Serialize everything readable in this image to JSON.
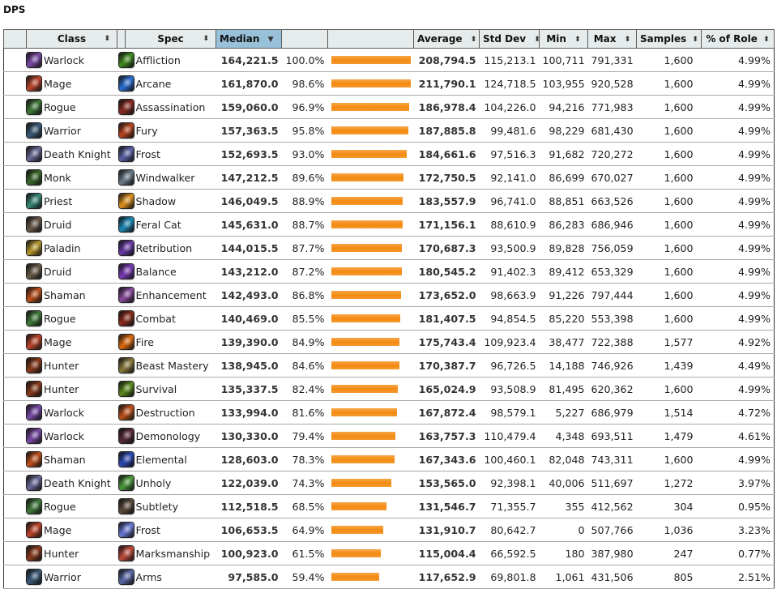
{
  "page": {
    "title": "DPS"
  },
  "colors": {
    "header_bg": "#e6ecec",
    "sorted_header_bg": "#98c0d8",
    "bar": "#f28a10",
    "row_border": "#a8a8a8"
  },
  "table": {
    "headers": {
      "class": "Class",
      "spec": "Spec",
      "median": "Median",
      "pct": "",
      "bar": "",
      "average": "Average",
      "stddev": "Std Dev",
      "min": "Min",
      "max": "Max",
      "samples": "Samples",
      "role": "% of Role"
    },
    "sort_icon": "⬍",
    "sorted_icon": "▼",
    "sorted_column": "Median",
    "rows": [
      {
        "class": "Warlock",
        "class_icon": "warlock-icon",
        "class_color": "#7a4aa8",
        "spec": "Affliction",
        "spec_icon": "affliction-icon",
        "spec_color": "#3f8a1e",
        "median": "164,221.5",
        "pct": "100.0%",
        "bar_fraction": 1.0,
        "average": "208,794.5",
        "stddev": "115,213.1",
        "min": "100,711",
        "max": "791,331",
        "samples": "1,600",
        "role": "4.99%"
      },
      {
        "class": "Mage",
        "class_icon": "mage-icon",
        "class_color": "#c0452a",
        "spec": "Arcane",
        "spec_icon": "arcane-icon",
        "spec_color": "#2a6fd6",
        "median": "161,870.0",
        "pct": "98.6%",
        "bar_fraction": 0.986,
        "average": "211,790.1",
        "stddev": "124,718.5",
        "min": "103,955",
        "max": "920,528",
        "samples": "1,600",
        "role": "4.99%"
      },
      {
        "class": "Rogue",
        "class_icon": "rogue-icon",
        "class_color": "#3f7a3a",
        "spec": "Assassination",
        "spec_icon": "assassination-icon",
        "spec_color": "#8a2a22",
        "median": "159,060.0",
        "pct": "96.9%",
        "bar_fraction": 0.969,
        "average": "186,978.4",
        "stddev": "104,226.0",
        "min": "94,216",
        "max": "771,983",
        "samples": "1,600",
        "role": "4.99%"
      },
      {
        "class": "Warrior",
        "class_icon": "warrior-icon",
        "class_color": "#3a5a78",
        "spec": "Fury",
        "spec_icon": "fury-icon",
        "spec_color": "#b8441c",
        "median": "157,363.5",
        "pct": "95.8%",
        "bar_fraction": 0.958,
        "average": "187,885.8",
        "stddev": "99,481.6",
        "min": "98,229",
        "max": "681,430",
        "samples": "1,600",
        "role": "4.99%"
      },
      {
        "class": "Death Knight",
        "class_icon": "death-knight-icon",
        "class_color": "#6a6a9a",
        "spec": "Frost",
        "spec_icon": "dk-frost-icon",
        "spec_color": "#5a62a8",
        "median": "152,693.5",
        "pct": "93.0%",
        "bar_fraction": 0.93,
        "average": "184,661.6",
        "stddev": "97,516.3",
        "min": "91,682",
        "max": "720,272",
        "samples": "1,600",
        "role": "4.99%"
      },
      {
        "class": "Monk",
        "class_icon": "monk-icon",
        "class_color": "#3a6a2a",
        "spec": "Windwalker",
        "spec_icon": "windwalker-icon",
        "spec_color": "#6a7a8a",
        "median": "147,212.5",
        "pct": "89.6%",
        "bar_fraction": 0.896,
        "average": "172,750.5",
        "stddev": "92,141.0",
        "min": "86,699",
        "max": "670,027",
        "samples": "1,600",
        "role": "4.99%"
      },
      {
        "class": "Priest",
        "class_icon": "priest-icon",
        "class_color": "#3a8a7a",
        "spec": "Shadow",
        "spec_icon": "shadow-icon",
        "spec_color": "#e0901a",
        "median": "146,049.5",
        "pct": "88.9%",
        "bar_fraction": 0.889,
        "average": "183,557.9",
        "stddev": "96,741.0",
        "min": "88,851",
        "max": "663,526",
        "samples": "1,600",
        "role": "4.99%"
      },
      {
        "class": "Druid",
        "class_icon": "druid-icon",
        "class_color": "#6a5a4a",
        "spec": "Feral Cat",
        "spec_icon": "feral-icon",
        "spec_color": "#1a8ab8",
        "median": "145,631.0",
        "pct": "88.7%",
        "bar_fraction": 0.887,
        "average": "171,156.1",
        "stddev": "88,610.9",
        "min": "86,283",
        "max": "686,946",
        "samples": "1,600",
        "role": "4.99%"
      },
      {
        "class": "Paladin",
        "class_icon": "paladin-icon",
        "class_color": "#b8962a",
        "spec": "Retribution",
        "spec_icon": "retribution-icon",
        "spec_color": "#6a3aa8",
        "median": "144,015.5",
        "pct": "87.7%",
        "bar_fraction": 0.877,
        "average": "170,687.3",
        "stddev": "93,500.9",
        "min": "89,828",
        "max": "756,059",
        "samples": "1,600",
        "role": "4.99%"
      },
      {
        "class": "Druid",
        "class_icon": "druid-icon",
        "class_color": "#6a5a4a",
        "spec": "Balance",
        "spec_icon": "balance-icon",
        "spec_color": "#7a3ab8",
        "median": "143,212.0",
        "pct": "87.2%",
        "bar_fraction": 0.872,
        "average": "180,545.2",
        "stddev": "91,402.3",
        "min": "89,412",
        "max": "653,329",
        "samples": "1,600",
        "role": "4.99%"
      },
      {
        "class": "Shaman",
        "class_icon": "shaman-icon",
        "class_color": "#c0501a",
        "spec": "Enhancement",
        "spec_icon": "enhancement-icon",
        "spec_color": "#8a4aa0",
        "median": "142,493.0",
        "pct": "86.8%",
        "bar_fraction": 0.868,
        "average": "173,652.0",
        "stddev": "98,663.9",
        "min": "91,226",
        "max": "797,444",
        "samples": "1,600",
        "role": "4.99%"
      },
      {
        "class": "Rogue",
        "class_icon": "rogue-icon",
        "class_color": "#3f7a3a",
        "spec": "Combat",
        "spec_icon": "combat-icon",
        "spec_color": "#8a2a1a",
        "median": "140,469.0",
        "pct": "85.5%",
        "bar_fraction": 0.855,
        "average": "181,407.5",
        "stddev": "94,854.5",
        "min": "85,220",
        "max": "553,398",
        "samples": "1,600",
        "role": "4.99%"
      },
      {
        "class": "Mage",
        "class_icon": "mage-icon",
        "class_color": "#c0452a",
        "spec": "Fire",
        "spec_icon": "fire-icon",
        "spec_color": "#e06a0a",
        "median": "139,390.0",
        "pct": "84.9%",
        "bar_fraction": 0.849,
        "average": "175,743.4",
        "stddev": "109,923.4",
        "min": "38,477",
        "max": "722,388",
        "samples": "1,577",
        "role": "4.92%"
      },
      {
        "class": "Hunter",
        "class_icon": "hunter-icon",
        "class_color": "#8a3a1a",
        "spec": "Beast Mastery",
        "spec_icon": "beast-mastery-icon",
        "spec_color": "#8a7a3a",
        "median": "138,945.0",
        "pct": "84.6%",
        "bar_fraction": 0.846,
        "average": "170,387.7",
        "stddev": "96,726.5",
        "min": "14,188",
        "max": "746,926",
        "samples": "1,439",
        "role": "4.49%"
      },
      {
        "class": "Hunter",
        "class_icon": "hunter-icon",
        "class_color": "#8a3a1a",
        "spec": "Survival",
        "spec_icon": "survival-icon",
        "spec_color": "#5a8a1a",
        "median": "135,337.5",
        "pct": "82.4%",
        "bar_fraction": 0.824,
        "average": "165,024.9",
        "stddev": "93,508.9",
        "min": "81,495",
        "max": "620,362",
        "samples": "1,600",
        "role": "4.99%"
      },
      {
        "class": "Warlock",
        "class_icon": "warlock-icon",
        "class_color": "#7a4aa8",
        "spec": "Destruction",
        "spec_icon": "destruction-icon",
        "spec_color": "#c0501a",
        "median": "133,994.0",
        "pct": "81.6%",
        "bar_fraction": 0.816,
        "average": "167,872.4",
        "stddev": "98,579.1",
        "min": "5,227",
        "max": "686,979",
        "samples": "1,514",
        "role": "4.72%"
      },
      {
        "class": "Warlock",
        "class_icon": "warlock-icon",
        "class_color": "#7a4aa8",
        "spec": "Demonology",
        "spec_icon": "demonology-icon",
        "spec_color": "#5a2a3a",
        "median": "130,330.0",
        "pct": "79.4%",
        "bar_fraction": 0.794,
        "average": "163,757.3",
        "stddev": "110,479.4",
        "min": "4,348",
        "max": "693,511",
        "samples": "1,479",
        "role": "4.61%"
      },
      {
        "class": "Shaman",
        "class_icon": "shaman-icon",
        "class_color": "#c0501a",
        "spec": "Elemental",
        "spec_icon": "elemental-icon",
        "spec_color": "#2a4ab8",
        "median": "128,603.0",
        "pct": "78.3%",
        "bar_fraction": 0.783,
        "average": "167,343.6",
        "stddev": "100,460.1",
        "min": "82,048",
        "max": "743,311",
        "samples": "1,600",
        "role": "4.99%"
      },
      {
        "class": "Death Knight",
        "class_icon": "death-knight-icon",
        "class_color": "#6a6a9a",
        "spec": "Unholy",
        "spec_icon": "unholy-icon",
        "spec_color": "#4a9a3a",
        "median": "122,039.0",
        "pct": "74.3%",
        "bar_fraction": 0.743,
        "average": "153,565.0",
        "stddev": "92,398.1",
        "min": "40,006",
        "max": "511,697",
        "samples": "1,272",
        "role": "3.97%"
      },
      {
        "class": "Rogue",
        "class_icon": "rogue-icon",
        "class_color": "#3f7a3a",
        "spec": "Subtlety",
        "spec_icon": "subtlety-icon",
        "spec_color": "#5a4a3a",
        "median": "112,518.5",
        "pct": "68.5%",
        "bar_fraction": 0.685,
        "average": "131,546.7",
        "stddev": "71,355.7",
        "min": "355",
        "max": "412,562",
        "samples": "304",
        "role": "0.95%"
      },
      {
        "class": "Mage",
        "class_icon": "mage-icon",
        "class_color": "#c0452a",
        "spec": "Frost",
        "spec_icon": "mage-frost-icon",
        "spec_color": "#6a7ad8",
        "median": "106,653.5",
        "pct": "64.9%",
        "bar_fraction": 0.649,
        "average": "131,910.7",
        "stddev": "80,642.7",
        "min": "0",
        "max": "507,766",
        "samples": "1,036",
        "role": "3.23%"
      },
      {
        "class": "Hunter",
        "class_icon": "hunter-icon",
        "class_color": "#8a3a1a",
        "spec": "Marksmanship",
        "spec_icon": "marksmanship-icon",
        "spec_color": "#c04a3a",
        "median": "100,923.0",
        "pct": "61.5%",
        "bar_fraction": 0.615,
        "average": "115,004.4",
        "stddev": "66,592.5",
        "min": "180",
        "max": "387,980",
        "samples": "247",
        "role": "0.77%"
      },
      {
        "class": "Warrior",
        "class_icon": "warrior-icon",
        "class_color": "#3a5a78",
        "spec": "Arms",
        "spec_icon": "arms-icon",
        "spec_color": "#5a6aa8",
        "median": "97,585.0",
        "pct": "59.4%",
        "bar_fraction": 0.594,
        "average": "117,652.9",
        "stddev": "69,801.8",
        "min": "1,061",
        "max": "431,506",
        "samples": "805",
        "role": "2.51%"
      }
    ]
  }
}
